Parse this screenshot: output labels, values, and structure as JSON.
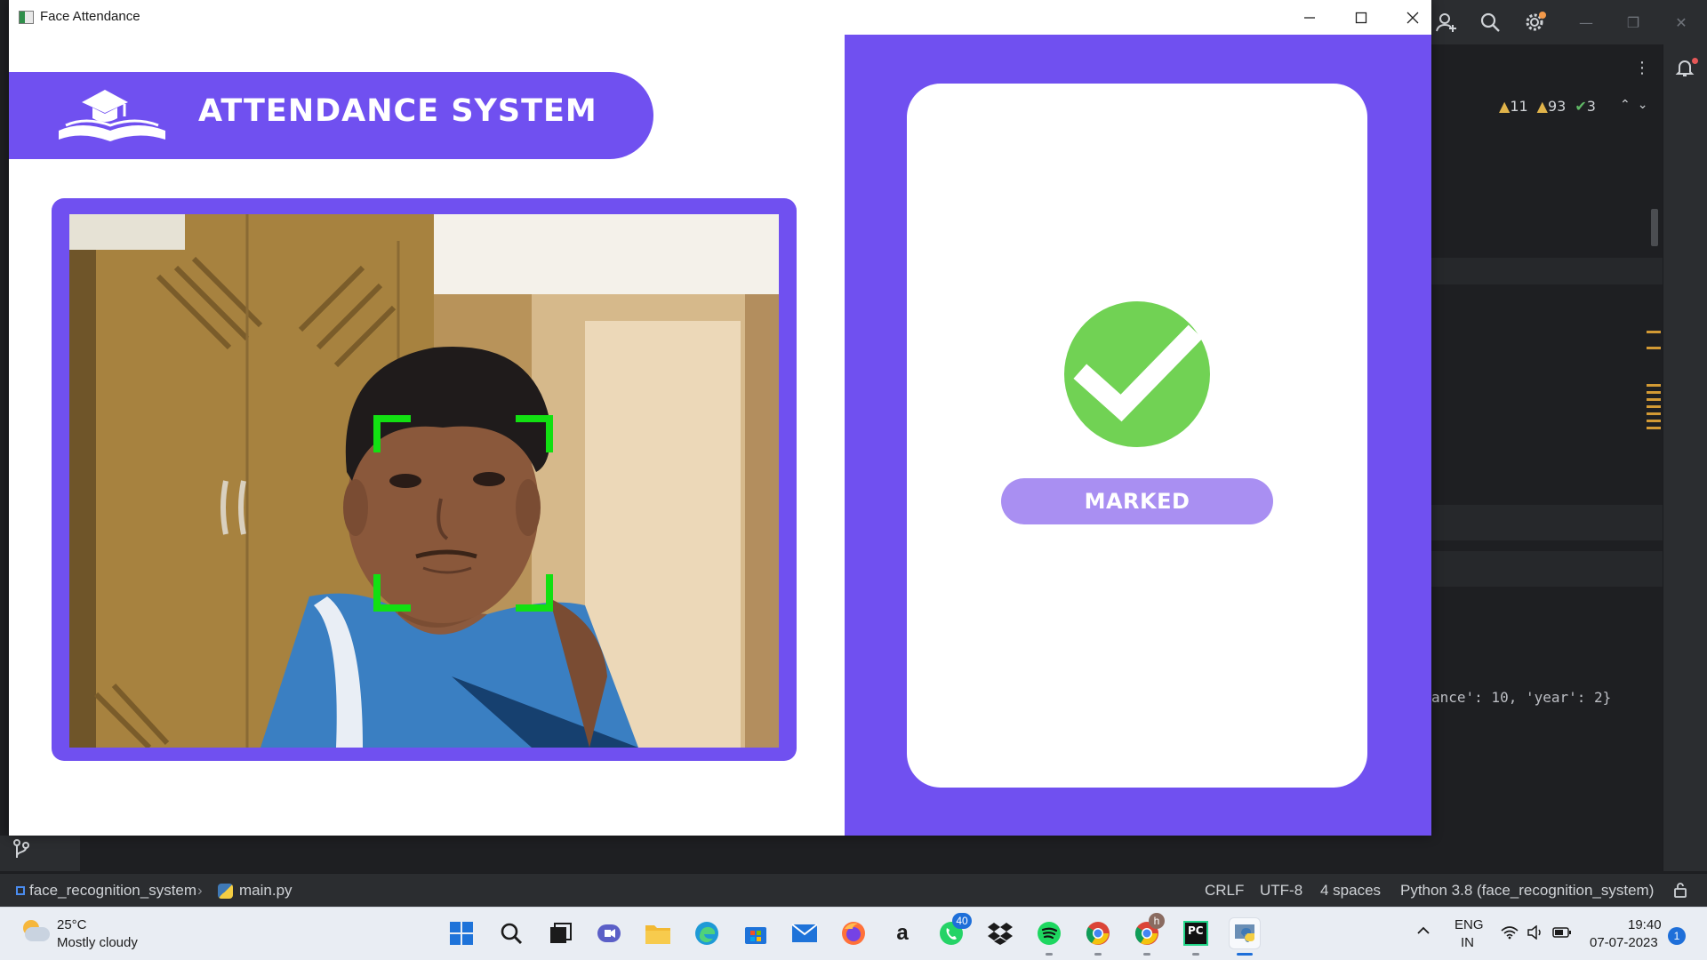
{
  "app_window": {
    "title": "Face Attendance",
    "header_title": "ATTENDANCE SYSTEM",
    "status_label": "MARKED",
    "status_icon": "checkmark-circle-icon",
    "face_bracket_color": "#12e012",
    "accent_color": "#7050f0"
  },
  "ide": {
    "inspections": {
      "warnings_a": "11",
      "warnings_b": "93",
      "ok": "3"
    },
    "code_snippet": "ance': 10, 'year': 2}",
    "statusbar": {
      "project": "face_recognition_system",
      "file": "main.py",
      "line_ending": "CRLF",
      "encoding": "UTF-8",
      "indent": "4 spaces",
      "interpreter": "Python 3.8 (face_recognition_system)"
    }
  },
  "taskbar": {
    "weather": {
      "temp": "25°C",
      "condition": "Mostly cloudy"
    },
    "apps": [
      {
        "name": "start",
        "icon": "windows-logo-icon"
      },
      {
        "name": "search",
        "icon": "search-icon"
      },
      {
        "name": "task-view",
        "icon": "task-view-icon"
      },
      {
        "name": "teams",
        "icon": "video-chat-icon"
      },
      {
        "name": "file-explorer",
        "icon": "folder-icon"
      },
      {
        "name": "edge",
        "icon": "edge-browser-icon"
      },
      {
        "name": "store",
        "icon": "store-icon"
      },
      {
        "name": "mail",
        "icon": "mail-icon"
      },
      {
        "name": "firefox",
        "icon": "firefox-icon"
      },
      {
        "name": "amazon",
        "icon": "amazon-icon"
      },
      {
        "name": "whatsapp",
        "icon": "whatsapp-icon",
        "badge": "40"
      },
      {
        "name": "dropbox",
        "icon": "dropbox-icon"
      },
      {
        "name": "spotify",
        "icon": "spotify-icon"
      },
      {
        "name": "chrome-1",
        "icon": "chrome-icon"
      },
      {
        "name": "chrome-2",
        "icon": "chrome-icon",
        "badge": "h"
      },
      {
        "name": "pycharm",
        "icon": "pycharm-icon",
        "label": "PC"
      },
      {
        "name": "python-app",
        "icon": "python-icon"
      }
    ],
    "tray": {
      "language": "ENG",
      "region": "IN",
      "time": "19:40",
      "date": "07-07-2023",
      "notifications": "1"
    }
  }
}
